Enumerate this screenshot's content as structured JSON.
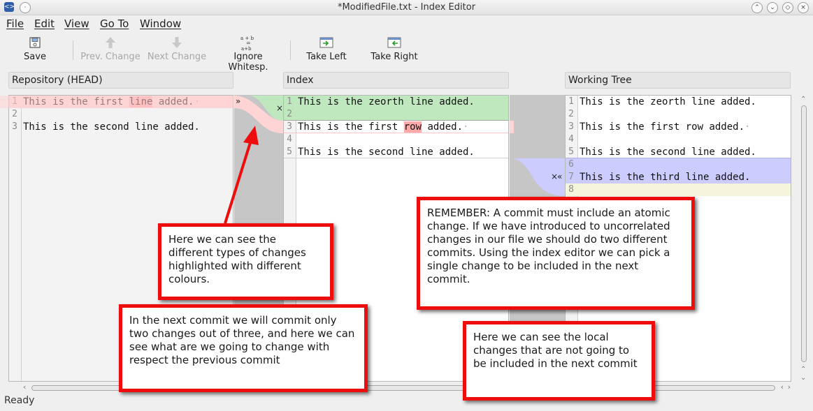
{
  "window": {
    "title": "*ModifiedFile.txt - Index Editor"
  },
  "menu": [
    "File",
    "Edit",
    "View",
    "Go To",
    "Window"
  ],
  "toolbar": {
    "save": "Save",
    "prev_change": "Prev. Change",
    "next_change": "Next Change",
    "ignore_whitespace": "Ignore Whitesp.",
    "take_left": "Take Left",
    "take_right": "Take Right"
  },
  "panes": {
    "repository": {
      "title": "Repository (HEAD)",
      "lines": [
        {
          "n": "1",
          "pre": "This is the first ",
          "word": "line",
          "post": " added.",
          "dot": "·"
        },
        {
          "n": "2",
          "text": ""
        },
        {
          "n": "3",
          "text": "This is the second line added."
        }
      ]
    },
    "index": {
      "title": "Index",
      "lines": [
        {
          "n": "1",
          "text": "This is the zeorth line added."
        },
        {
          "n": "2",
          "text": ""
        },
        {
          "n": "3",
          "pre": "This is the first ",
          "word": "row",
          "post": " added.",
          "dot": "·"
        },
        {
          "n": "4",
          "text": ""
        },
        {
          "n": "5",
          "text": "This is the second line added."
        }
      ]
    },
    "working": {
      "title": "Working Tree",
      "lines": [
        {
          "n": "1",
          "text": "This is the zeorth line added."
        },
        {
          "n": "2",
          "text": ""
        },
        {
          "n": "3",
          "text": "This is the first row added.",
          "dot": "·"
        },
        {
          "n": "4",
          "text": ""
        },
        {
          "n": "5",
          "text": "This is the second line added."
        },
        {
          "n": "6",
          "text": ""
        },
        {
          "n": "7",
          "text": "This is the third line added."
        },
        {
          "n": "8",
          "text": ""
        }
      ]
    }
  },
  "connector_marks": {
    "right_arrow": "»",
    "close_left": "×",
    "close_right": "×",
    "left_arrow": "«"
  },
  "status": "Ready",
  "callouts": {
    "colours": "Here we can see the different types of changes highlighted with different colours.",
    "next_commit": "In the next commit we will commit only two changes out of three, and here we can see what are we going to change with respect the previous commit",
    "remember": "REMEMBER: A commit must include an atomic change. If we have introduced to uncorrelated changes in our file we should do two different commits. Using the index editor we can pick a single change to be included in the next commit.",
    "local": "Here we can see the local changes that are not going to be included in the next commit"
  },
  "colors": {
    "deleted": "#ffd4d4",
    "added": "#bfe8bf",
    "local": "#ccccff",
    "callout_border": "#ee0d0d"
  }
}
